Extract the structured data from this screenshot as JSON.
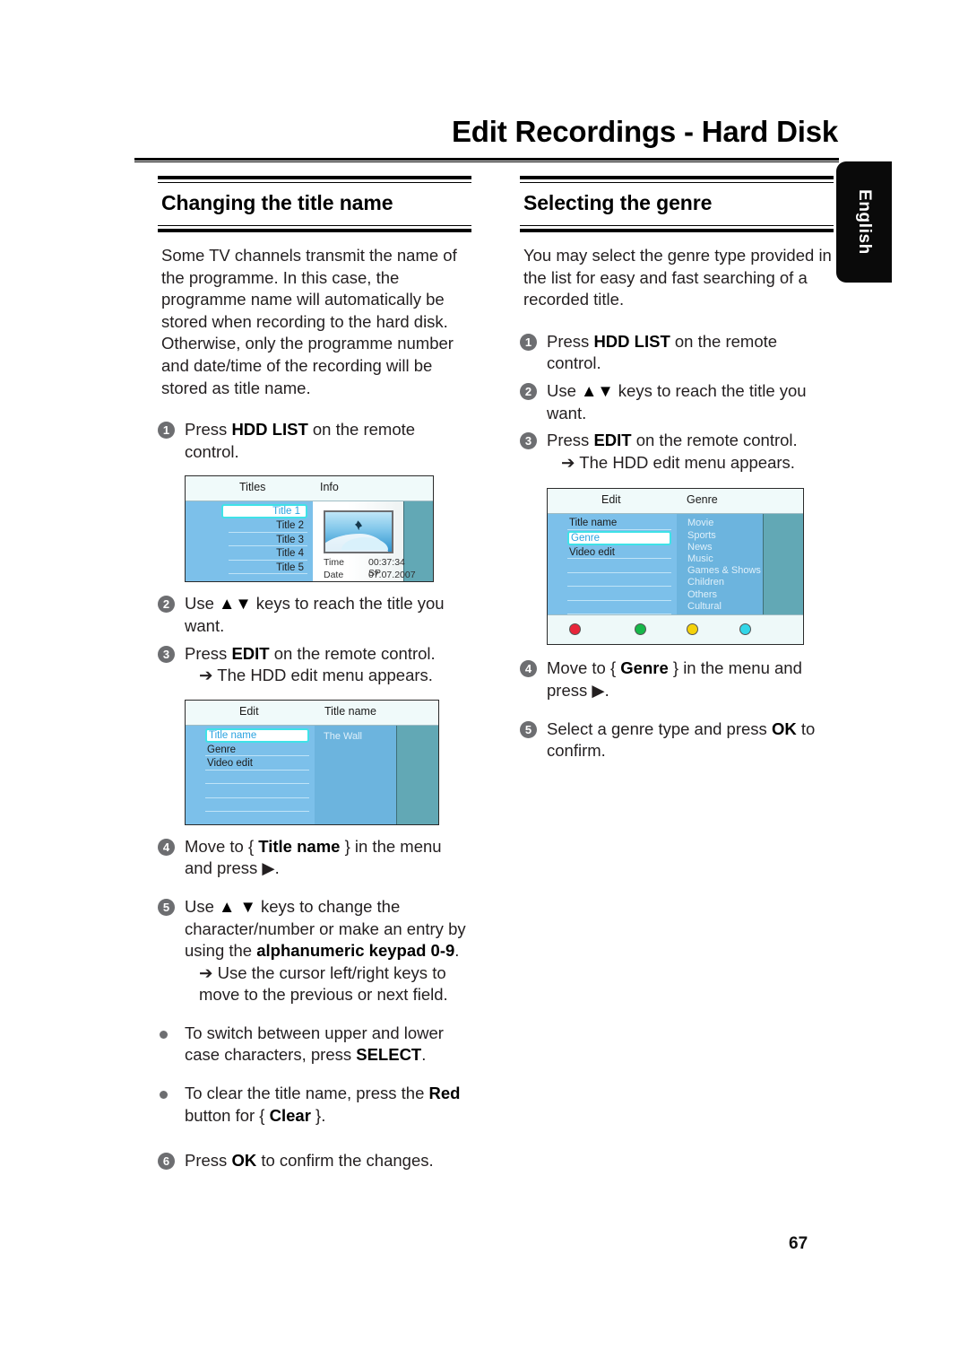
{
  "page": {
    "title": "Edit Recordings - Hard Disk",
    "language_tab": "English",
    "page_number": "67"
  },
  "left_column": {
    "heading": "Changing the title name",
    "intro": "Some TV channels transmit the name of the programme. In this case, the programme name will automatically be stored when recording to the hard disk. Otherwise, only the programme number and date/time of the recording will be stored as title name.",
    "steps": [
      {
        "num": "1",
        "text_before": "Press ",
        "bold": "HDD LIST",
        "text_after": " on the remote control."
      },
      {
        "num": "2",
        "text_before": "Use ",
        "bold": "▲▼",
        "text_after": " keys to reach the title you want."
      },
      {
        "num": "3",
        "text_before": "Press ",
        "bold": "EDIT",
        "text_after": " on the remote control."
      },
      {
        "num": "4",
        "text_before": "Move to { ",
        "bold": "Title name",
        "text_after": " } in the menu and press ▶."
      },
      {
        "num": "5",
        "text_before": "Use ",
        "bold": "▲ ▼",
        "text_after": " keys to change the character/number or make an entry by using the "
      },
      {
        "num": "6",
        "text_before": "Press ",
        "bold": "OK",
        "text_after": " to confirm the changes."
      }
    ],
    "step3_note": "➔ The HDD edit menu appears.",
    "step5_bold_tail": "alphanumeric keypad 0-9",
    "step5_note": "➔ Use the cursor left/right keys to move to the previous or next field.",
    "bullets": [
      {
        "text_before": "To switch between upper and lower case characters, press ",
        "bold": "SELECT",
        "text_after": "."
      },
      {
        "text_before": "To clear the title name, press the ",
        "bold": "Red",
        "text_after": " button for { ",
        "bold2": "Clear",
        "text_after2": " }."
      }
    ]
  },
  "right_column": {
    "heading": "Selecting the genre",
    "intro": "You may select the genre type provided in the list for easy and fast searching of a recorded title.",
    "steps": [
      {
        "num": "1",
        "text_before": "Press ",
        "bold": "HDD LIST",
        "text_after": " on the remote control."
      },
      {
        "num": "2",
        "text_before": "Use ",
        "bold": "▲▼",
        "text_after": " keys to reach the title you want."
      },
      {
        "num": "3",
        "text_before": "Press ",
        "bold": "EDIT",
        "text_after": " on the remote control."
      },
      {
        "num": "4",
        "text_before": "Move to { ",
        "bold": "Genre",
        "text_after": " } in the menu and press ▶."
      },
      {
        "num": "5",
        "text_before": "Select a genre type and press ",
        "bold": "OK",
        "text_after": " to confirm."
      }
    ],
    "step3_note": "➔ The HDD edit menu appears."
  },
  "screens": {
    "titles_list": {
      "header_left": "Titles",
      "header_right": "Info",
      "items": [
        "Title 1",
        "Title 2",
        "Title 3",
        "Title 4",
        "Title 5"
      ],
      "selected_index": 0,
      "info": {
        "time_label": "Time",
        "time_value": "00:37:34  SP",
        "date_label": "Date",
        "date_value": "07.07.2007"
      }
    },
    "edit_title_name": {
      "header_left": "Edit",
      "header_right": "Title name",
      "items": [
        "Title name",
        "Genre",
        "Video edit"
      ],
      "selected_index": 0,
      "value": "The Wall"
    },
    "edit_genre": {
      "header_left": "Edit",
      "header_right": "Genre",
      "items": [
        "Title name",
        "Genre",
        "Video edit"
      ],
      "selected_index": 1,
      "genres": [
        "Movie",
        "Sports",
        "News",
        "Music",
        "Games & Shows",
        "Children",
        "Others",
        "Cultural"
      ],
      "colour_buttons": [
        "#e8253a",
        "#16b84a",
        "#f4d20a",
        "#32d6e8"
      ]
    }
  }
}
